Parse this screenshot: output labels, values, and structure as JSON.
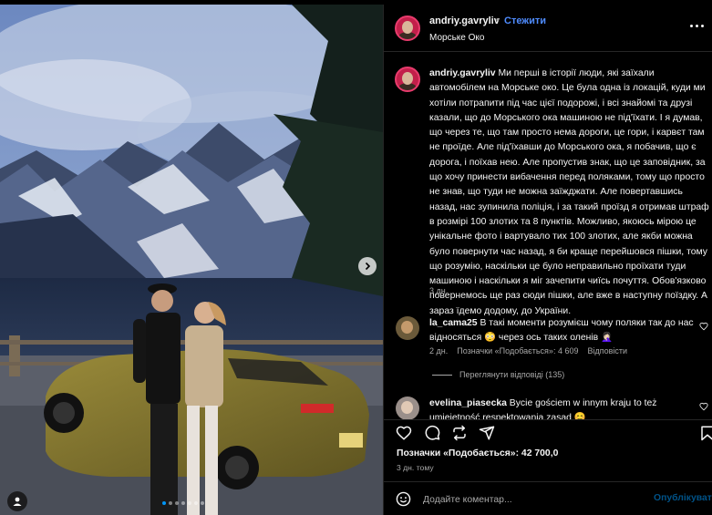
{
  "post": {
    "username": "andriy.gavryliv",
    "separator": "•",
    "follow_label": "Стежити",
    "location": "Морське Око",
    "more_icon": "more-horizontal-icon"
  },
  "photo": {
    "next_icon": "chevron-right-icon",
    "user_tag_icon": "user-icon",
    "carousel_dots": 7,
    "active_dot": 0
  },
  "caption": {
    "username": "andriy.gavryliv",
    "text": " Ми перші в історії люди, які заїхали автомобілем на Морське око. Це була одна із локацій, куди ми хотіли потрапити під час цієї подорожі, і всі знайомі та друзі казали, що до Морського ока машиною не під'їхати. І я думав, що через те, що там просто нема дороги, це гори, і карвєт там не проїде. Але під'їхавши до Морського ока, я побачив, що є дорога, і поїхав нею. Але пропустив знак, що це заповідник, за що хочу принести вибачення перед поляками, тому що просто не знав, що туди не можна заїжджати. Але повертавшись назад, нас зупинила поліція, і за такий проїзд я отримав штраф в розмірі 100 злотих та 8 пунктів. Можливо, якоюсь мірою це унікальне фото і вартувало тих 100 злотих, але якби можна було повернути час назад, я би краще перейшовся пішки, тому що розумію, наскільки це було неправильно проїхати туди машиною і наскільки я міг зачепити чиїсь почуття. Обов'язково повернемось ще раз сюди пішки, але вже в наступну поїздку. А зараз їдемо додому, до України.",
    "time": "3 дн."
  },
  "comments": [
    {
      "username": "la_cama25",
      "text": " В такі моменти розумієш чому поляки так до нас відносяться 😳 через ось таких оленів 🤦🏻‍♀️",
      "time": "2 дн.",
      "likes": "Позначки «Подобається»: 4 609",
      "reply_label": "Відповісти",
      "view_replies": "Переглянути відповіді (135)"
    },
    {
      "username": "evelina_piasecka",
      "text": " Bycie gościem w innym kraju to też umiejętność respektowania zasad 😊"
    }
  ],
  "actions": {
    "like_icon": "heart-icon",
    "comment_icon": "comment-icon",
    "share_icon": "share-icon",
    "repost_icon": "repost-icon",
    "save_icon": "bookmark-icon"
  },
  "likes": "Позначки «Подобається»: 42 700,0",
  "post_time": "3 дн. тому",
  "add_comment": {
    "placeholder": "Додайте коментар...",
    "publish_label": "Опублікувати",
    "emoji_icon": "emoji-icon"
  },
  "colors": {
    "background": "#000000",
    "follow": "#4f8cff",
    "publish": "#0095f6",
    "muted": "#a8a8a8",
    "divider": "#262626"
  }
}
